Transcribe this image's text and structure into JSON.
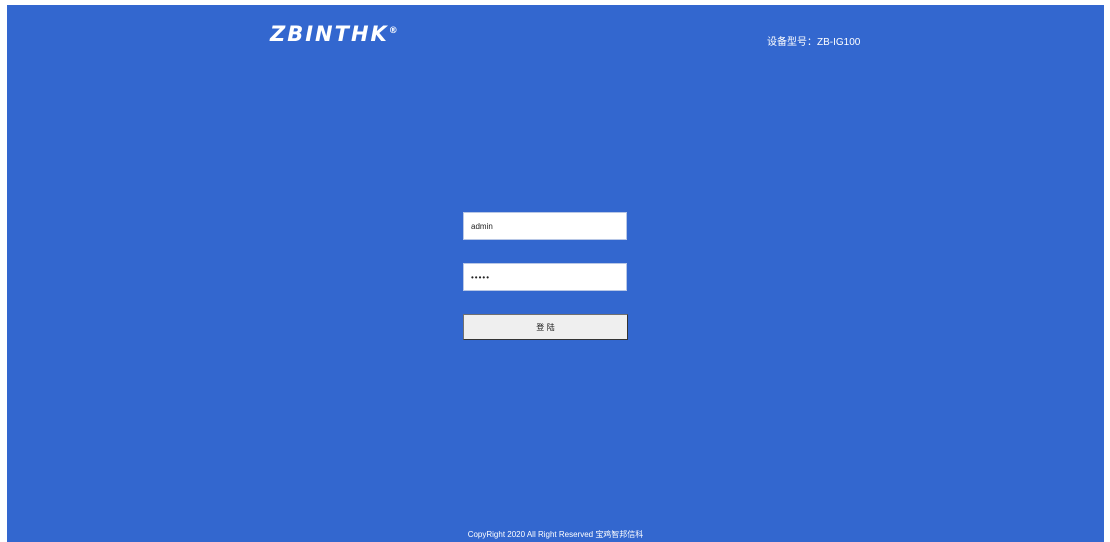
{
  "header": {
    "logo_text": "ZBINTHK",
    "logo_mark": "®",
    "device_model": "设备型号：ZB-IG100"
  },
  "login": {
    "username_value": "admin",
    "password_value": "12345",
    "login_label": "登 陆"
  },
  "footer": {
    "copyright": "CopyRight 2020 All Right Reserved 宝鸡智邦信科"
  },
  "colors": {
    "background": "#3367cf",
    "text": "#ffffff",
    "button_bg": "#efefef"
  }
}
